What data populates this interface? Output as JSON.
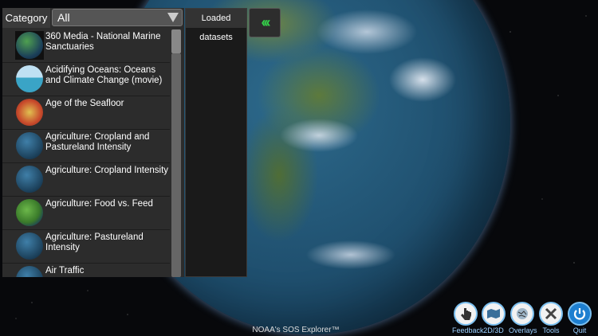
{
  "category": {
    "label": "Category",
    "selected": "All"
  },
  "datasets": [
    {
      "label": "360 Media - National Marine Sanctuaries",
      "thumb": "media"
    },
    {
      "label": "Acidifying Oceans: Oceans and Climate Change (movie)",
      "thumb": "ocean"
    },
    {
      "label": "Age of the Seafloor",
      "thumb": "seafloor"
    },
    {
      "label": "Agriculture: Cropland and Pastureland Intensity",
      "thumb": "earth"
    },
    {
      "label": "Agriculture: Cropland Intensity",
      "thumb": "earth"
    },
    {
      "label": "Agriculture: Food vs. Feed",
      "thumb": "food"
    },
    {
      "label": "Agriculture: Pastureland Intensity",
      "thumb": "earth"
    },
    {
      "label": "Air Traffic",
      "thumb": "earth"
    }
  ],
  "loaded": {
    "title": "Loaded datasets"
  },
  "collapse": {
    "glyph": "‹‹‹"
  },
  "brand": "NOAA's SOS Explorer™",
  "toolbar": [
    {
      "label": "Feedback",
      "icon": "hand-pointer-icon"
    },
    {
      "label": "2D/3D",
      "icon": "map-fold-icon"
    },
    {
      "label": "Overlays",
      "icon": "overlays-icon"
    },
    {
      "label": "Tools",
      "icon": "tools-icon"
    },
    {
      "label": "Quit",
      "icon": "power-icon"
    }
  ],
  "colors": {
    "accent": "#35d24a",
    "toolbar_label": "#9cd0ff"
  }
}
